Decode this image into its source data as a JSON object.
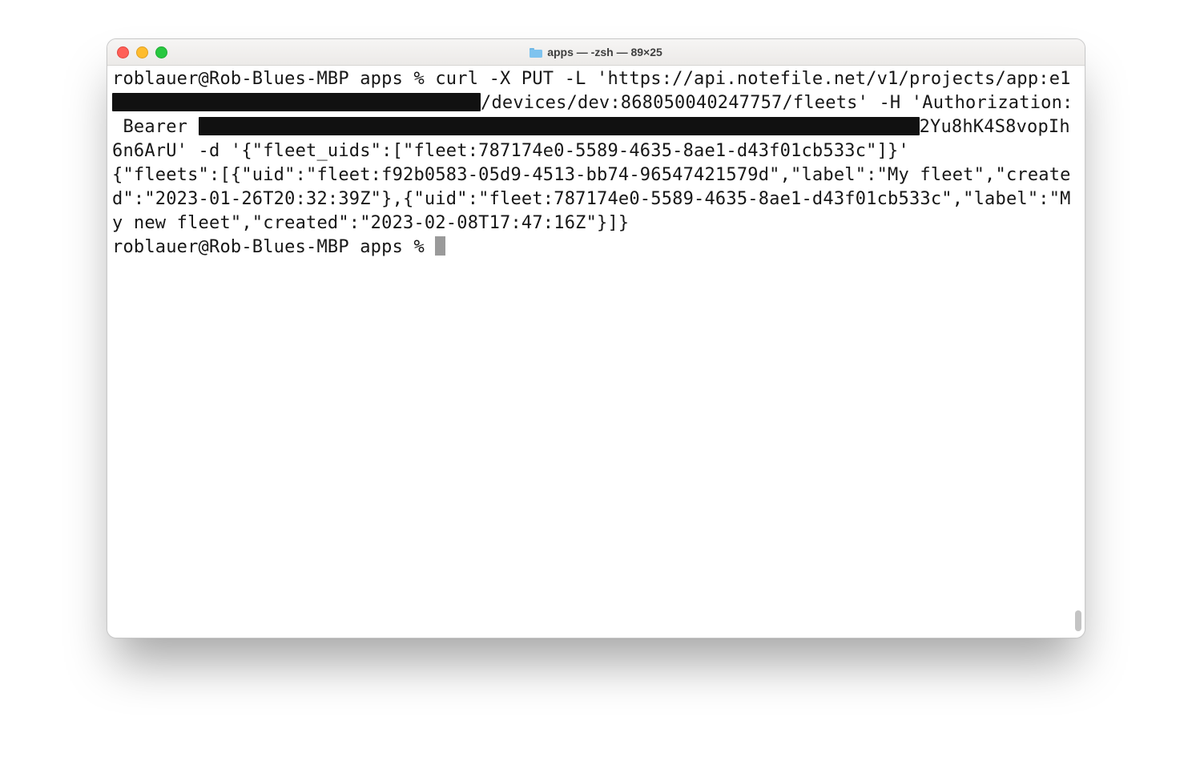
{
  "window": {
    "title": "apps — -zsh — 89×25"
  },
  "terminal": {
    "prompt1_a": "roblauer@Rob-Blues-MBP apps % curl -X PUT -L 'https://api.notefile.net/v1/projects/app:e1",
    "line2_after_redact": "/devices/dev:868050040247757/fleets' -H 'Authorization:",
    "line3_before_redact": " Bearer ",
    "line3_after_redact": "2Yu8hK4S8vopIh",
    "line4": "6n6ArU' -d '{\"fleet_uids\":[\"fleet:787174e0-5589-4635-8ae1-d43f01cb533c\"]}'",
    "response": "{\"fleets\":[{\"uid\":\"fleet:f92b0583-05d9-4513-bb74-96547421579d\",\"label\":\"My fleet\",\"created\":\"2023-01-26T20:32:39Z\"},{\"uid\":\"fleet:787174e0-5589-4635-8ae1-d43f01cb533c\",\"label\":\"My new fleet\",\"created\":\"2023-02-08T17:47:16Z\"}]}",
    "prompt2": "roblauer@Rob-Blues-MBP apps % "
  }
}
